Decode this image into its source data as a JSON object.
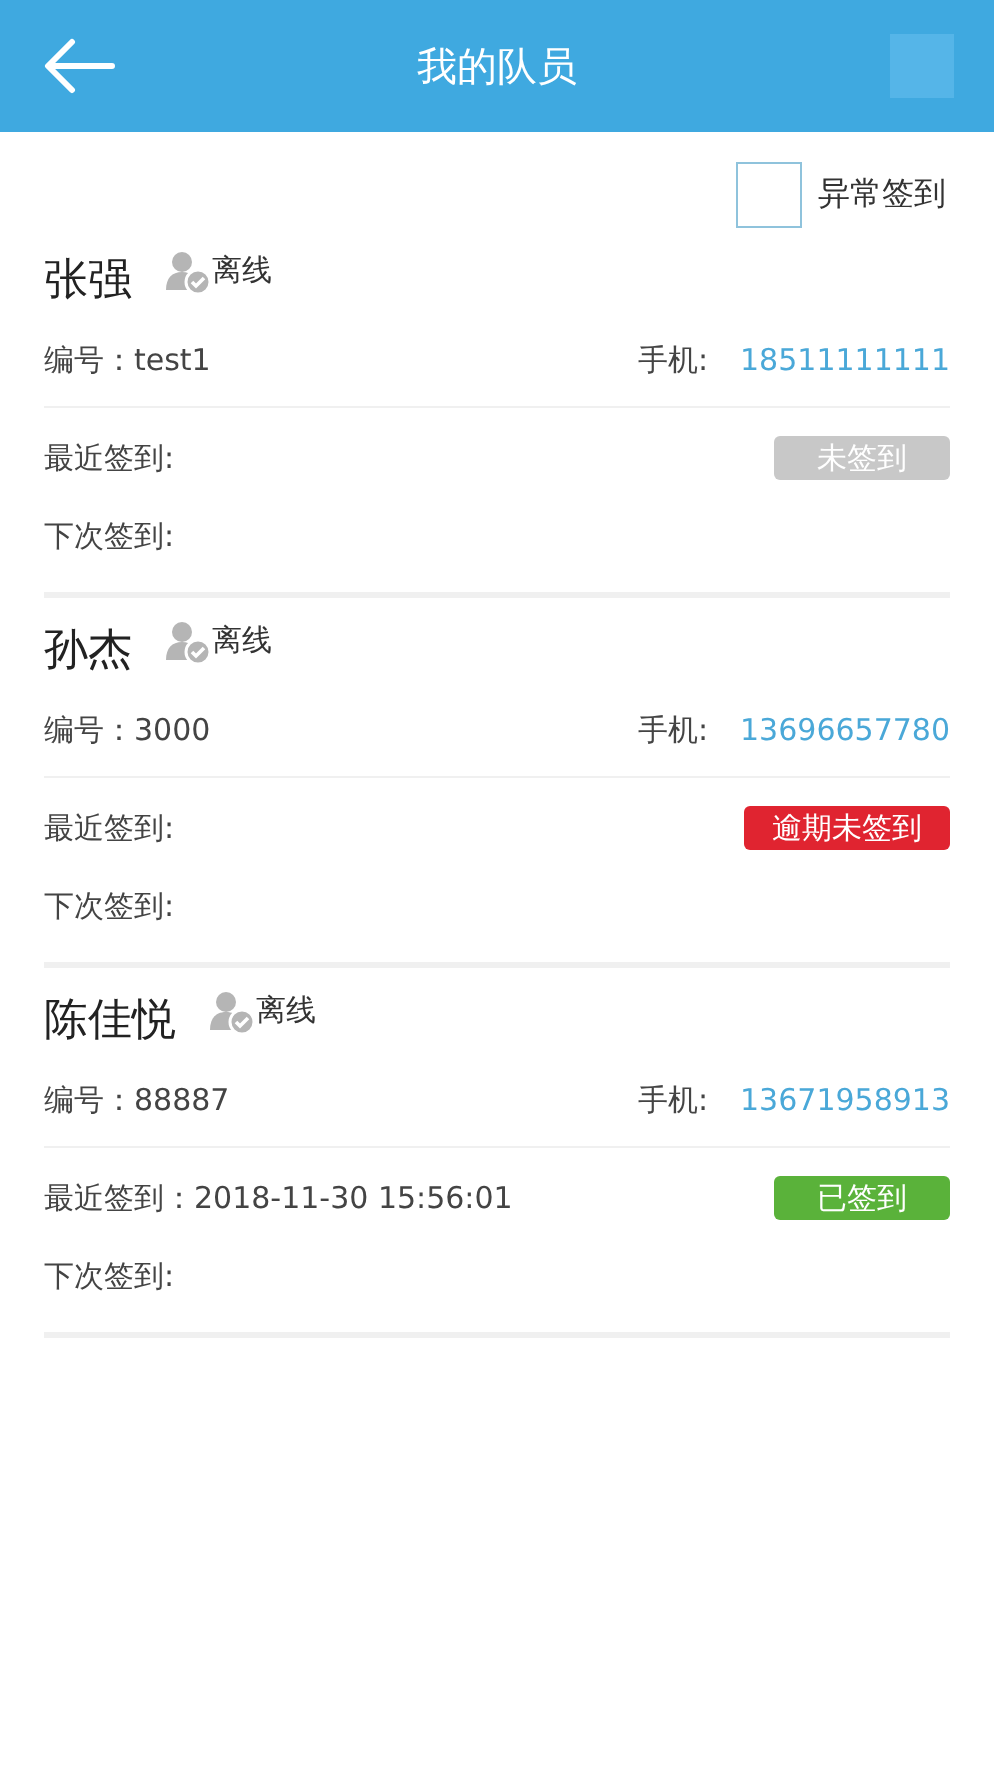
{
  "header": {
    "title": "我的队员"
  },
  "filter": {
    "label": "异常签到",
    "checked": false
  },
  "members": [
    {
      "name": "张强",
      "online": false,
      "presence": "离线",
      "id_line": "编号：test1",
      "phone_label": "手机:",
      "phone": "18511111111",
      "last_checkin": "最近签到:",
      "status": {
        "kind": "none",
        "label": "未签到"
      },
      "next_checkin": "下次签到:"
    },
    {
      "name": "孙杰",
      "online": false,
      "presence": "离线",
      "id_line": "编号：3000",
      "phone_label": "手机:",
      "phone": "13696657780",
      "last_checkin": "最近签到:",
      "status": {
        "kind": "overdue",
        "label": "逾期未签到"
      },
      "next_checkin": "下次签到:"
    },
    {
      "name": "陈佳悦",
      "online": false,
      "presence": "离线",
      "id_line": "编号：88887",
      "phone_label": "手机:",
      "phone": "13671958913",
      "last_checkin": "最近签到：2018-11-30 15:56:01",
      "status": {
        "kind": "signed",
        "label": "已签到"
      },
      "next_checkin": "下次签到:"
    }
  ]
}
